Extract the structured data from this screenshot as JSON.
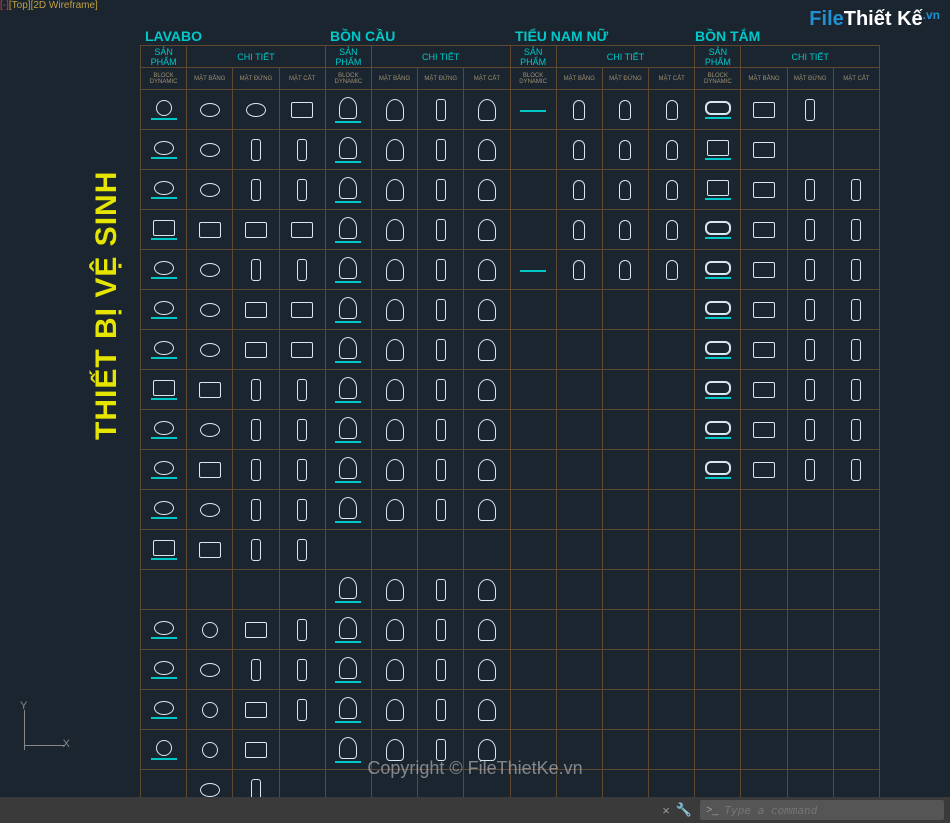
{
  "viewport": {
    "prefix": "[-]",
    "top": "[Top]",
    "wf": "[2D Wireframe]"
  },
  "logo": {
    "part1": "File",
    "part2": "Thiết Kế",
    "suffix": ".vn"
  },
  "sidetitle": "THIẾT BỊ VỆ SINH",
  "watermark": "Copyright © FileThietKe.vn",
  "sections": [
    "LAVABO",
    "BỒN CẦU",
    "TIỂU NAM NỮ",
    "BỒN TẮM"
  ],
  "header": {
    "sp": "SẢN PHẨM",
    "ct": "CHI TIẾT",
    "block": "BLOCK DYNAMIC",
    "mb": "MẶT BẰNG",
    "md": "MẶT ĐỨNG",
    "mc": "MẶT CẮT"
  },
  "rows": [
    [
      "circ",
      "oval",
      "oval",
      "rect",
      "seat",
      "seat",
      "tall",
      "seat",
      "underline",
      "urinal",
      "urinal",
      "urinal",
      "tub",
      "rect",
      "tall",
      ""
    ],
    [
      "oval",
      "oval",
      "tall",
      "tall",
      "seat",
      "seat",
      "tall",
      "seat",
      "",
      "urinal",
      "urinal",
      "urinal",
      "rect",
      "rect",
      "",
      ""
    ],
    [
      "oval",
      "oval",
      "tall",
      "tall",
      "seat",
      "seat",
      "tall",
      "seat",
      "",
      "urinal",
      "urinal",
      "urinal",
      "rect",
      "rect",
      "tall",
      "tall"
    ],
    [
      "rect",
      "rect",
      "rect",
      "rect",
      "seat",
      "seat",
      "tall",
      "seat",
      "",
      "urinal",
      "urinal",
      "urinal",
      "tub",
      "rect",
      "tall",
      "tall"
    ],
    [
      "oval",
      "oval",
      "tall",
      "tall",
      "seat",
      "seat",
      "tall",
      "seat",
      "underline",
      "urinal",
      "urinal",
      "urinal",
      "tub",
      "rect",
      "tall",
      "tall"
    ],
    [
      "oval",
      "oval",
      "rect",
      "rect",
      "seat",
      "seat",
      "tall",
      "seat",
      "",
      "",
      "",
      "",
      "tub",
      "rect",
      "tall",
      "tall"
    ],
    [
      "oval",
      "oval",
      "rect",
      "rect",
      "seat",
      "seat",
      "tall",
      "seat",
      "",
      "",
      "",
      "",
      "tub",
      "rect",
      "tall",
      "tall"
    ],
    [
      "rect",
      "rect",
      "tall",
      "tall",
      "seat",
      "seat",
      "tall",
      "seat",
      "",
      "",
      "",
      "",
      "tub",
      "rect",
      "tall",
      "tall"
    ],
    [
      "oval",
      "oval",
      "tall",
      "tall",
      "seat",
      "seat",
      "tall",
      "seat",
      "",
      "",
      "",
      "",
      "tub",
      "rect",
      "tall",
      "tall"
    ],
    [
      "oval",
      "rect",
      "tall",
      "tall",
      "seat",
      "seat",
      "tall",
      "seat",
      "",
      "",
      "",
      "",
      "tub",
      "rect",
      "tall",
      "tall"
    ],
    [
      "oval",
      "oval",
      "tall",
      "tall",
      "seat",
      "seat",
      "tall",
      "seat",
      "",
      "",
      "",
      "",
      "",
      "",
      "",
      ""
    ],
    [
      "rect",
      "rect",
      "tall",
      "tall",
      "",
      "",
      "",
      "",
      "",
      "",
      "",
      "",
      "",
      "",
      "",
      ""
    ],
    [
      "",
      "",
      "",
      "",
      "seat",
      "seat",
      "tall",
      "seat",
      "",
      "",
      "",
      "",
      "",
      "",
      "",
      ""
    ],
    [
      "oval",
      "circ",
      "rect",
      "tall",
      "seat",
      "seat",
      "tall",
      "seat",
      "",
      "",
      "",
      "",
      "",
      "",
      "",
      ""
    ],
    [
      "oval",
      "oval",
      "tall",
      "tall",
      "seat",
      "seat",
      "tall",
      "seat",
      "",
      "",
      "",
      "",
      "",
      "",
      "",
      ""
    ],
    [
      "oval",
      "circ",
      "rect",
      "tall",
      "seat",
      "seat",
      "tall",
      "seat",
      "",
      "",
      "",
      "",
      "",
      "",
      "",
      ""
    ],
    [
      "circ",
      "circ",
      "rect",
      "",
      "seat",
      "seat",
      "tall",
      "seat",
      "",
      "",
      "",
      "",
      "",
      "",
      "",
      ""
    ],
    [
      "",
      "oval",
      "tall",
      "",
      "",
      "",
      "",
      "",
      "",
      "",
      "",
      "",
      "",
      "",
      "",
      ""
    ]
  ],
  "cmd": {
    "placeholder": "Type a command",
    "close": "×",
    "wrench": "🔧",
    "chevron": ">_"
  },
  "ucs": {
    "x": "X",
    "y": "Y"
  }
}
